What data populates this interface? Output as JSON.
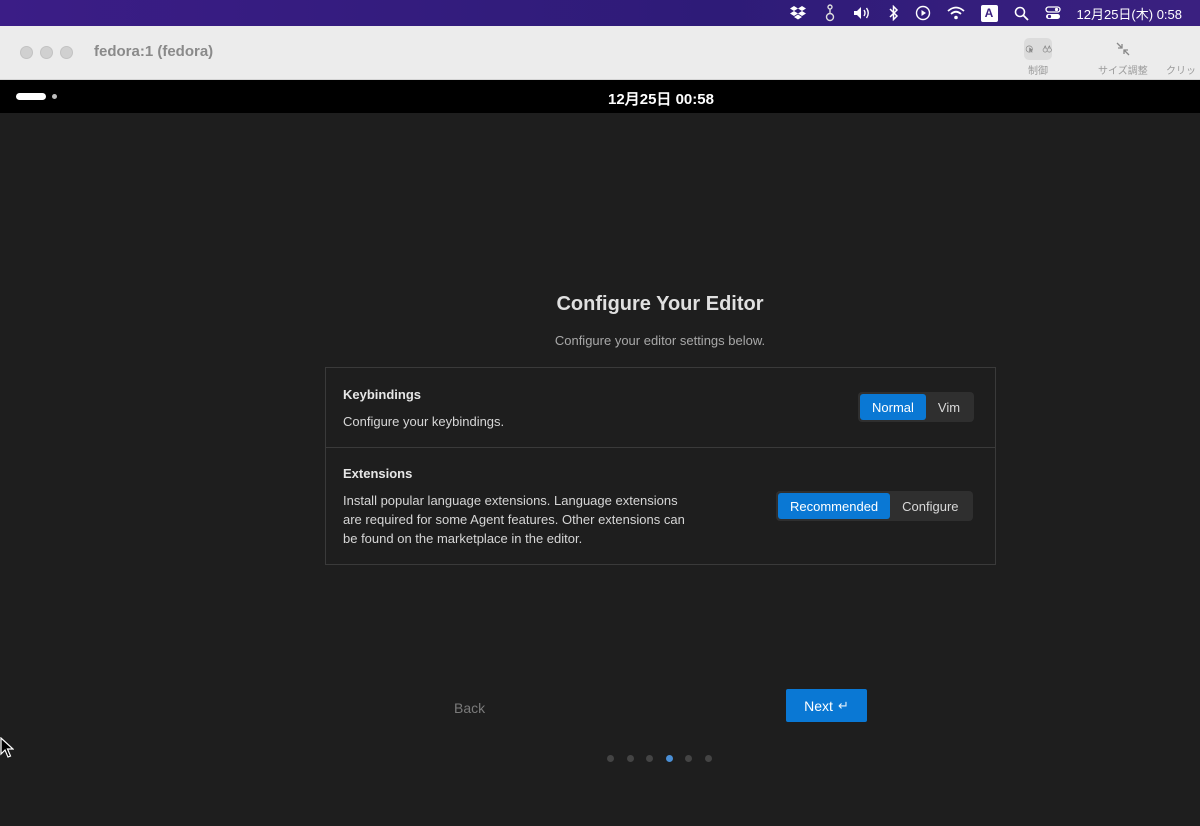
{
  "menubar": {
    "datetime": "12月25日(木)  0:58",
    "ime": "A"
  },
  "window": {
    "title": "fedora:1 (fedora)",
    "toolbar": {
      "control_label": "制御",
      "resize_label": "サイズ調整",
      "clip_label": "クリッ"
    }
  },
  "guest": {
    "clock": "12月25日  00:58"
  },
  "setup": {
    "heading": "Configure Your Editor",
    "subheading": "Configure your editor settings below.",
    "keybindings": {
      "title": "Keybindings",
      "description": "Configure your keybindings.",
      "options": [
        "Normal",
        "Vim"
      ],
      "selected": "Normal"
    },
    "extensions": {
      "title": "Extensions",
      "description_lines": [
        "Install popular language extensions. Language extensions",
        "are required for some Agent features. Other extensions can",
        "be found on the marketplace in the editor."
      ],
      "options": [
        "Recommended",
        "Configure"
      ],
      "selected": "Recommended"
    },
    "back_label": "Back",
    "next_label": "Next",
    "next_icon": "↵",
    "step_current": 4,
    "step_total": 6
  },
  "colors": {
    "accent": "#0a78d4",
    "active_dot": "#4a8fd6"
  }
}
